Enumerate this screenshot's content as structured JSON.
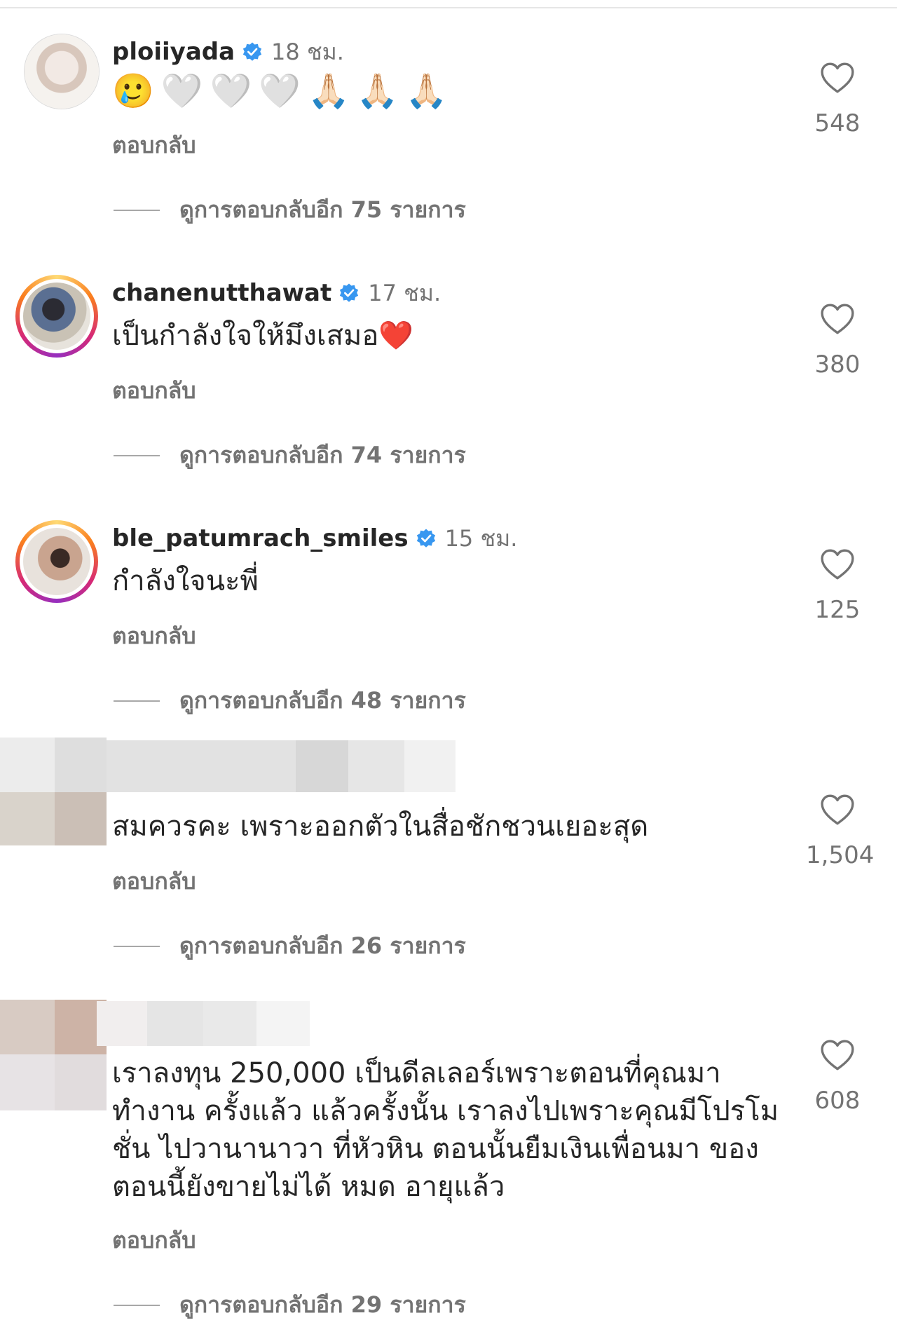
{
  "comments": [
    {
      "username": "ploiiyada",
      "time": "18 ชม.",
      "emojis": [
        "🥲",
        "🤍",
        "🤍",
        "🤍",
        "🙏🏻",
        "🙏🏻",
        "🙏🏻"
      ],
      "reply_label": "ตอบกลับ",
      "more_replies": "ดูการตอบกลับอีก 75 รายการ",
      "likes": "548"
    },
    {
      "username": "chanenutthawat",
      "time": "17 ชม.",
      "text": "เป็นกำลังใจให้มึงเสมอ❤️",
      "reply_label": "ตอบกลับ",
      "more_replies": "ดูการตอบกลับอีก 74 รายการ",
      "likes": "380"
    },
    {
      "username": "ble_patumrach_smiles",
      "time": "15 ชม.",
      "text": "กำลังใจนะพี่",
      "reply_label": "ตอบกลับ",
      "more_replies": "ดูการตอบกลับอีก 48 รายการ",
      "likes": "125"
    },
    {
      "text": "สมควรคะ เพราะออกตัวในสื่อชักชวนเยอะสุด",
      "reply_label": "ตอบกลับ",
      "more_replies": "ดูการตอบกลับอีก 26 รายการ",
      "likes": "1,504"
    },
    {
      "text_lines": [
        "เราลงทุน 250,000 เป็นดีลเลอร์เพราะตอนที่คุณมา",
        "ทำงาน ครั้งแล้ว แล้วครั้งนั้น เราลงไปเพราะคุณมีโปรโม",
        "ชั่น ไปวานานาวา ที่หัวหิน ตอนนั้นยืมเงินเพื่อนมา ของ",
        "ตอนนี้ยังขายไม่ได้ หมด อายุแล้ว"
      ],
      "reply_label": "ตอบกลับ",
      "more_replies": "ดูการตอบกลับอีก 29 รายการ",
      "likes": "608"
    }
  ],
  "icons": {
    "verified": "verified-badge-icon",
    "like": "heart-outline-icon"
  },
  "colors": {
    "verified_blue": "#3897f0",
    "secondary_text": "#737373",
    "primary_text": "#262626"
  }
}
